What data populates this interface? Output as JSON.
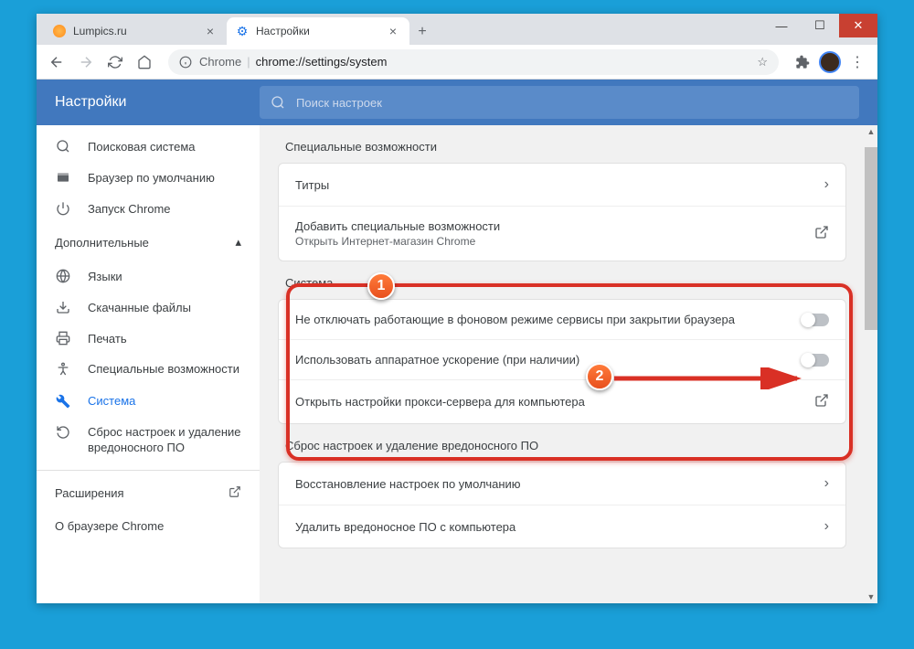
{
  "window": {
    "tabs": [
      {
        "title": "Lumpics.ru",
        "active": false
      },
      {
        "title": "Настройки",
        "active": true
      }
    ]
  },
  "toolbar": {
    "chrome_label": "Chrome",
    "url": "chrome://settings/system"
  },
  "header": {
    "title": "Настройки",
    "search_placeholder": "Поиск настроек"
  },
  "sidebar": {
    "items": [
      {
        "label": "Поисковая система"
      },
      {
        "label": "Браузер по умолчанию"
      },
      {
        "label": "Запуск Chrome"
      }
    ],
    "advanced_label": "Дополнительные",
    "advanced_items": [
      {
        "label": "Языки"
      },
      {
        "label": "Скачанные файлы"
      },
      {
        "label": "Печать"
      },
      {
        "label": "Специальные возможности"
      },
      {
        "label": "Система"
      },
      {
        "label": "Сброс настроек и удаление вредоносного ПО"
      }
    ],
    "extensions_label": "Расширения",
    "about_label": "О браузере Chrome"
  },
  "main": {
    "accessibility": {
      "title": "Специальные возможности",
      "captions": "Титры",
      "add_title": "Добавить специальные возможности",
      "add_sub": "Открыть Интернет-магазин Chrome"
    },
    "system": {
      "title": "Система",
      "bg_apps": "Не отключать работающие в фоновом режиме сервисы при закрытии браузера",
      "hw_accel": "Использовать аппаратное ускорение (при наличии)",
      "proxy": "Открыть настройки прокси-сервера для компьютера"
    },
    "reset": {
      "title": "Сброс настроек и удаление вредоносного ПО",
      "restore": "Восстановление настроек по умолчанию",
      "cleanup": "Удалить вредоносное ПО с компьютера"
    }
  },
  "annotations": {
    "marker1": "1",
    "marker2": "2"
  }
}
